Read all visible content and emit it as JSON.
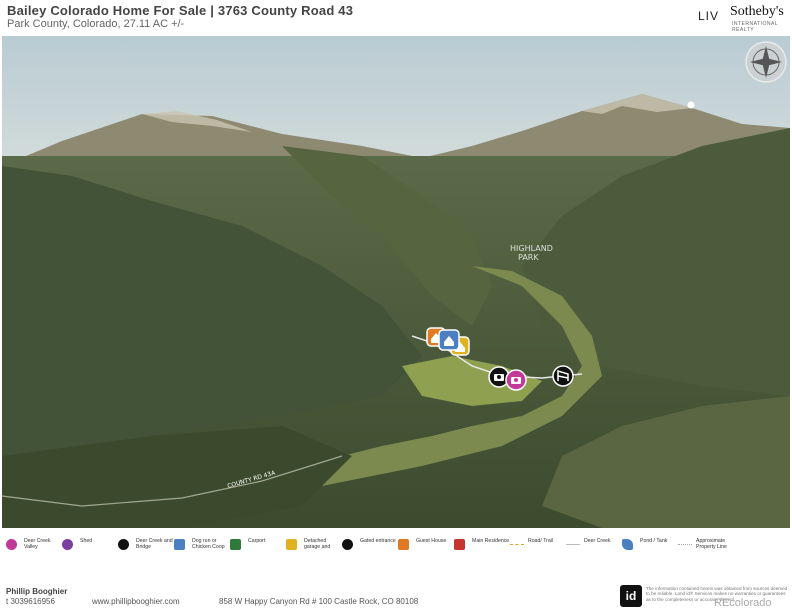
{
  "header": {
    "title": "Bailey Colorado Home For Sale | 3763 County Road 43",
    "subtitle": "Park County, Colorado, 27.11 AC +/-",
    "logo_liv": "LIV",
    "logo_sothebys": "Sotheby's",
    "logo_sothebys_sub": "INTERNATIONAL REALTY"
  },
  "map": {
    "place_label_line1": "HIGHLAND",
    "place_label_line2": "PARK",
    "road_label": "COUNTY RD 43A",
    "compass_icon": "compass-rose-icon"
  },
  "legend": [
    {
      "label": "Deer Creek Valley",
      "icon": "camera-icon",
      "color": "#c2399a",
      "type": "icon"
    },
    {
      "label": "Shed",
      "icon": "home-icon",
      "color": "#7b3fa0",
      "type": "icon"
    },
    {
      "label": "Deer Creek and Bridge",
      "icon": "camera-icon",
      "color": "#111111",
      "type": "icon"
    },
    {
      "label": "Dog run or Chicken Coop",
      "icon": "home-icon",
      "color": "#4a7fc1",
      "type": "icon"
    },
    {
      "label": "Carport",
      "icon": "home-icon",
      "color": "#2f7a3a",
      "type": "icon"
    },
    {
      "label": "Detached garage and",
      "icon": "home-icon",
      "color": "#e0b21f",
      "type": "icon"
    },
    {
      "label": "Gated entrance",
      "icon": "gate-icon",
      "color": "#111111",
      "type": "icon"
    },
    {
      "label": "Guest House",
      "icon": "home-icon",
      "color": "#e07a22",
      "type": "icon"
    },
    {
      "label": "Main Residence",
      "icon": "home-icon",
      "color": "#c7332f",
      "type": "icon"
    },
    {
      "label": "Road/ Trail",
      "icon": "dashed-line-icon",
      "color": "#d9a62a",
      "type": "line"
    },
    {
      "label": "Deer Creek",
      "icon": "line-icon",
      "color": "#dddddd",
      "type": "line"
    },
    {
      "label": "Pond / Tank",
      "icon": "pond-icon",
      "color": "#4a7fc1",
      "type": "icon"
    },
    {
      "label": "Approximate Property Line",
      "icon": "dotted-line-icon",
      "color": "#cccccc",
      "type": "line"
    }
  ],
  "footer": {
    "agent_name": "Phillip Booghier",
    "phone": "t 3039616956",
    "website": "www.phillipbooghier.com",
    "address": "858 W Happy Canyon Rd # 100 Castle Rock, CO 80108",
    "badge": "id",
    "disclaimer": "The information contained herein was obtained from sources deemed to be reliable. Land id® Services makes no warranties or guarantees as to the completeness or accuracy thereof.",
    "recolorado": "REcolorado"
  }
}
